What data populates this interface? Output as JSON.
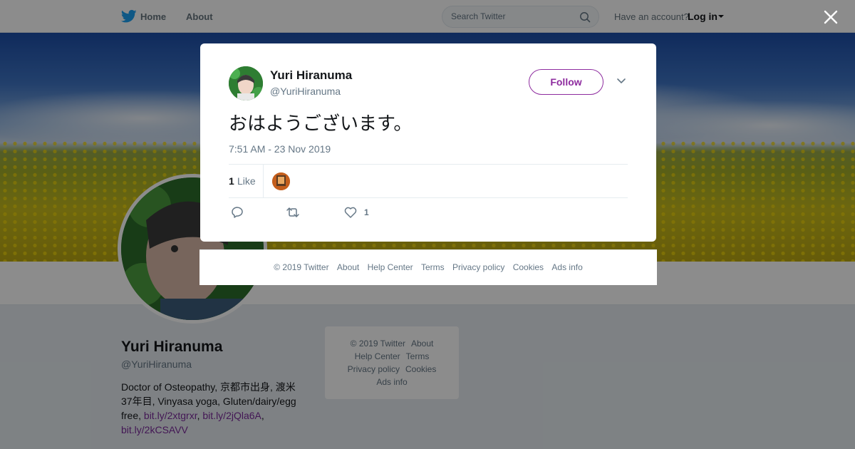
{
  "topbar": {
    "home_label": "Home",
    "about_label": "About",
    "search_placeholder": "Search Twitter",
    "account_prompt": "Have an account?",
    "login_label": "Log in"
  },
  "profile": {
    "name": "Yuri Hiranuma",
    "handle": "@YuriHiranuma",
    "bio_text": "Doctor of Osteopathy, 京都市出身, 渡米37年目, Vinyasa yoga, Gluten/dairy/egg free, ",
    "bio_links": [
      "bit.ly/2xtgrxr",
      "bit.ly/2jQla6A",
      "bit.ly/2kCSAVV"
    ]
  },
  "sidebar_footer": {
    "items": [
      "© 2019 Twitter",
      "About",
      "Help Center",
      "Terms",
      "Privacy policy",
      "Cookies",
      "Ads info"
    ]
  },
  "tweet": {
    "author_name": "Yuri Hiranuma",
    "author_handle": "@YuriHiranuma",
    "follow_label": "Follow",
    "text": "おはようございます。",
    "timestamp": "7:51 AM - 23 Nov 2019",
    "like_count": "1",
    "like_label": "Like",
    "action_like_count": "1"
  },
  "modal_footer": {
    "items": [
      "© 2019 Twitter",
      "About",
      "Help Center",
      "Terms",
      "Privacy policy",
      "Cookies",
      "Ads info"
    ]
  },
  "colors": {
    "follow_accent": "#8e2c9f",
    "link_color": "#7b2b9b",
    "twitter_blue": "#1da1f2"
  }
}
